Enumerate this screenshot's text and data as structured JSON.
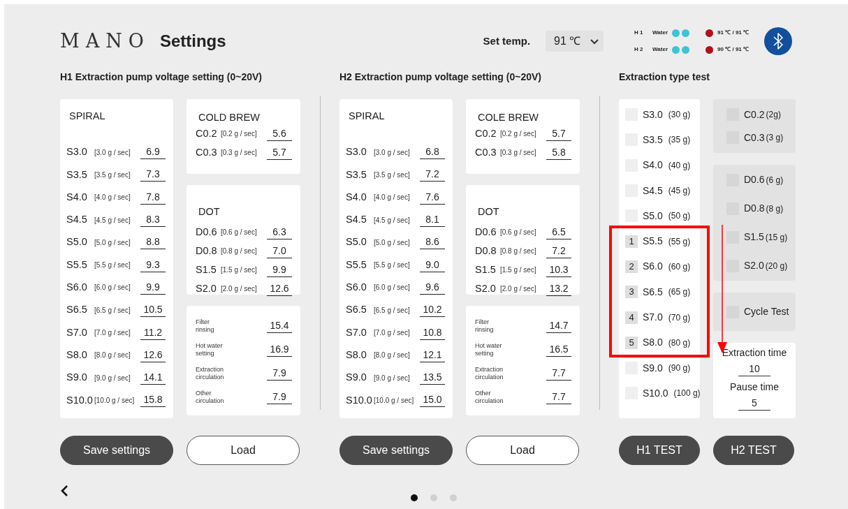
{
  "header": {
    "logo": "MANO",
    "title": "Settings",
    "set_temp_label": "Set temp.",
    "set_temp_value": "91 ℃",
    "heaters": [
      {
        "name": "H 1",
        "water_label": "Water",
        "temp": "91 ℃ / 91 ℃"
      },
      {
        "name": "H 2",
        "water_label": "Water",
        "temp": "90 ℃ / 91 ℃"
      }
    ]
  },
  "sections": [
    {
      "title": "H1 Extraction pump voltage setting (0~20V)",
      "spiral": {
        "title": "SPIRAL",
        "rows": [
          {
            "code": "S3.0",
            "rate": "[3.0 g / sec]",
            "value": "6.9"
          },
          {
            "code": "S3.5",
            "rate": "[3.5 g / sec]",
            "value": "7.3"
          },
          {
            "code": "S4.0",
            "rate": "[4.0 g / sec]",
            "value": "7.8"
          },
          {
            "code": "S4.5",
            "rate": "[4.5 g / sec]",
            "value": "8.3"
          },
          {
            "code": "S5.0",
            "rate": "[5.0 g / sec]",
            "value": "8.8"
          },
          {
            "code": "S5.5",
            "rate": "[5.5 g / sec]",
            "value": "9.3"
          },
          {
            "code": "S6.0",
            "rate": "[6.0 g / sec]",
            "value": "9.9"
          },
          {
            "code": "S6.5",
            "rate": "[6.5 g / sec]",
            "value": "10.5"
          },
          {
            "code": "S7.0",
            "rate": "[7.0 g / sec]",
            "value": "11.2"
          },
          {
            "code": "S8.0",
            "rate": "[8.0 g / sec]",
            "value": "12.6"
          },
          {
            "code": "S9.0",
            "rate": "[9.0 g / sec]",
            "value": "14.1"
          },
          {
            "code": "S10.0",
            "rate": "[10.0 g / sec]",
            "value": "15.8"
          }
        ]
      },
      "cold_brew": {
        "title": "COLD BREW",
        "rows": [
          {
            "code": "C0.2",
            "rate": "[0.2 g / sec]",
            "value": "5.6"
          },
          {
            "code": "C0.3",
            "rate": "[0.3 g / sec]",
            "value": "5.7"
          }
        ]
      },
      "dot": {
        "title": "DOT",
        "rows": [
          {
            "code": "D0.6",
            "rate": "[0.6 g / sec]",
            "value": "6.3"
          },
          {
            "code": "D0.8",
            "rate": "[0.8 g / sec]",
            "value": "7.0"
          },
          {
            "code": "S1.5",
            "rate": "[1.5 g / sec]",
            "value": "9.9"
          },
          {
            "code": "S2.0",
            "rate": "[2.0 g / sec]",
            "value": "12.6"
          }
        ]
      },
      "other": {
        "rows": [
          {
            "label": "Filter rinsing",
            "value": "15.4"
          },
          {
            "label": "Hot water setting",
            "value": "16.9"
          },
          {
            "label": "Extraction circulation",
            "value": "7.9"
          },
          {
            "label": "Other circulation",
            "value": "7.9"
          }
        ]
      },
      "buttons": [
        {
          "label": "Save settings",
          "kind": "filled"
        },
        {
          "label": "Load",
          "kind": "outline"
        }
      ]
    },
    {
      "title": "H2 Extraction pump voltage setting (0~20V)",
      "spiral": {
        "title": "SPIRAL",
        "rows": [
          {
            "code": "S3.0",
            "rate": "[3.0 g / sec]",
            "value": "6.8"
          },
          {
            "code": "S3.5",
            "rate": "[3.5 g / sec]",
            "value": "7.2"
          },
          {
            "code": "S4.0",
            "rate": "[4.0 g / sec]",
            "value": "7.6"
          },
          {
            "code": "S4.5",
            "rate": "[4.5 g / sec]",
            "value": "8.1"
          },
          {
            "code": "S5.0",
            "rate": "[5.0 g / sec]",
            "value": "8.6"
          },
          {
            "code": "S5.5",
            "rate": "[5.5 g / sec]",
            "value": "9.0"
          },
          {
            "code": "S6.0",
            "rate": "[6.0 g / sec]",
            "value": "9.6"
          },
          {
            "code": "S6.5",
            "rate": "[6.5 g / sec]",
            "value": "10.2"
          },
          {
            "code": "S7.0",
            "rate": "[7.0 g / sec]",
            "value": "10.8"
          },
          {
            "code": "S8.0",
            "rate": "[8.0 g / sec]",
            "value": "12.1"
          },
          {
            "code": "S9.0",
            "rate": "[9.0 g / sec]",
            "value": "13.5"
          },
          {
            "code": "S10.0",
            "rate": "[10.0 g / sec]",
            "value": "15.0"
          }
        ]
      },
      "cold_brew": {
        "title": "COLE BREW",
        "rows": [
          {
            "code": "C0.2",
            "rate": "[0.2 g / sec]",
            "value": "5.7"
          },
          {
            "code": "C0.3",
            "rate": "[0.3 g / sec]",
            "value": "5.8"
          }
        ]
      },
      "dot": {
        "title": "DOT",
        "rows": [
          {
            "code": "D0.6",
            "rate": "[0.6 g / sec]",
            "value": "6.5"
          },
          {
            "code": "D0.8",
            "rate": "[0.8 g / sec]",
            "value": "7.2"
          },
          {
            "code": "S1.5",
            "rate": "[1.5 g / sec]",
            "value": "10.3"
          },
          {
            "code": "S2.0",
            "rate": "[2.0 g / sec]",
            "value": "13.2"
          }
        ]
      },
      "other": {
        "rows": [
          {
            "label": "Filter rinsing",
            "value": "14.7"
          },
          {
            "label": "Hot water setting",
            "value": "16.5"
          },
          {
            "label": "Extraction circulation",
            "value": "7.7"
          },
          {
            "label": "Other circulation",
            "value": "7.7"
          }
        ]
      },
      "buttons": [
        {
          "label": "Save settings",
          "kind": "filled"
        },
        {
          "label": "Load",
          "kind": "outline"
        }
      ]
    }
  ],
  "test": {
    "title": "Extraction type test",
    "items": [
      {
        "code": "S3.0",
        "amount": "(30 g)",
        "checked": false
      },
      {
        "code": "S3.5",
        "amount": "(35 g)",
        "checked": false
      },
      {
        "code": "S4.0",
        "amount": "(40 g)",
        "checked": false
      },
      {
        "code": "S4.5",
        "amount": "(45 g)",
        "checked": false
      },
      {
        "code": "S5.0",
        "amount": "(50 g)",
        "checked": false
      },
      {
        "code": "S5.5",
        "amount": "(55 g)",
        "checked": true,
        "order": "1"
      },
      {
        "code": "S6.0",
        "amount": "(60 g)",
        "checked": true,
        "order": "2"
      },
      {
        "code": "S6.5",
        "amount": "(65 g)",
        "checked": true,
        "order": "3"
      },
      {
        "code": "S7.0",
        "amount": "(70 g)",
        "checked": true,
        "order": "4"
      },
      {
        "code": "S8.0",
        "amount": "(80 g)",
        "checked": true,
        "order": "5"
      },
      {
        "code": "S9.0",
        "amount": "(90 g)",
        "checked": false
      },
      {
        "code": "S10.0",
        "amount": "(100 g)",
        "checked": false
      }
    ],
    "groups": [
      {
        "items": [
          {
            "code": "C0.2",
            "amount": "(2g)",
            "checked": false
          },
          {
            "code": "C0.3",
            "amount": "(3 g)",
            "checked": false
          }
        ]
      },
      {
        "items": [
          {
            "code": "D0.6",
            "amount": "(6 g)",
            "checked": false
          },
          {
            "code": "D0.8",
            "amount": "(8 g)",
            "checked": false
          },
          {
            "code": "S1.5",
            "amount": "(15 g)",
            "checked": false
          },
          {
            "code": "S2.0",
            "amount": "(20 g)",
            "checked": false
          }
        ]
      },
      {
        "items": [
          {
            "code": "Cycle Test",
            "checked": false
          }
        ]
      }
    ],
    "times": [
      {
        "label": "Extraction time",
        "value": "10"
      },
      {
        "label": "Pause time",
        "value": "5"
      }
    ],
    "buttons": [
      "H1 TEST",
      "H2 TEST"
    ]
  },
  "pagination": [
    {
      "selected": true
    },
    {
      "selected": false
    },
    {
      "selected": false
    }
  ]
}
